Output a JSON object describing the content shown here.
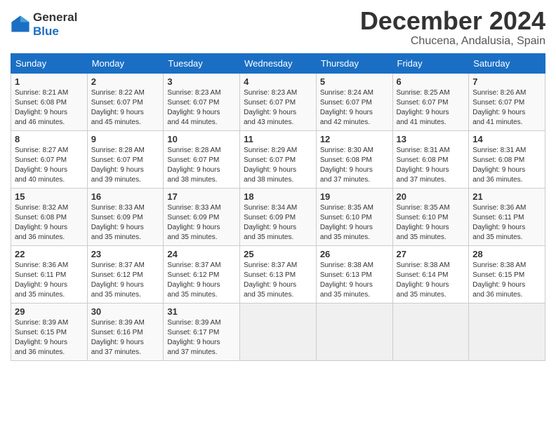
{
  "header": {
    "logo_line1": "General",
    "logo_line2": "Blue",
    "month": "December 2024",
    "location": "Chucena, Andalusia, Spain"
  },
  "weekdays": [
    "Sunday",
    "Monday",
    "Tuesday",
    "Wednesday",
    "Thursday",
    "Friday",
    "Saturday"
  ],
  "weeks": [
    [
      {
        "day": "1",
        "info": "Sunrise: 8:21 AM\nSunset: 6:08 PM\nDaylight: 9 hours\nand 46 minutes."
      },
      {
        "day": "2",
        "info": "Sunrise: 8:22 AM\nSunset: 6:07 PM\nDaylight: 9 hours\nand 45 minutes."
      },
      {
        "day": "3",
        "info": "Sunrise: 8:23 AM\nSunset: 6:07 PM\nDaylight: 9 hours\nand 44 minutes."
      },
      {
        "day": "4",
        "info": "Sunrise: 8:23 AM\nSunset: 6:07 PM\nDaylight: 9 hours\nand 43 minutes."
      },
      {
        "day": "5",
        "info": "Sunrise: 8:24 AM\nSunset: 6:07 PM\nDaylight: 9 hours\nand 42 minutes."
      },
      {
        "day": "6",
        "info": "Sunrise: 8:25 AM\nSunset: 6:07 PM\nDaylight: 9 hours\nand 41 minutes."
      },
      {
        "day": "7",
        "info": "Sunrise: 8:26 AM\nSunset: 6:07 PM\nDaylight: 9 hours\nand 41 minutes."
      }
    ],
    [
      {
        "day": "8",
        "info": "Sunrise: 8:27 AM\nSunset: 6:07 PM\nDaylight: 9 hours\nand 40 minutes."
      },
      {
        "day": "9",
        "info": "Sunrise: 8:28 AM\nSunset: 6:07 PM\nDaylight: 9 hours\nand 39 minutes."
      },
      {
        "day": "10",
        "info": "Sunrise: 8:28 AM\nSunset: 6:07 PM\nDaylight: 9 hours\nand 38 minutes."
      },
      {
        "day": "11",
        "info": "Sunrise: 8:29 AM\nSunset: 6:07 PM\nDaylight: 9 hours\nand 38 minutes."
      },
      {
        "day": "12",
        "info": "Sunrise: 8:30 AM\nSunset: 6:08 PM\nDaylight: 9 hours\nand 37 minutes."
      },
      {
        "day": "13",
        "info": "Sunrise: 8:31 AM\nSunset: 6:08 PM\nDaylight: 9 hours\nand 37 minutes."
      },
      {
        "day": "14",
        "info": "Sunrise: 8:31 AM\nSunset: 6:08 PM\nDaylight: 9 hours\nand 36 minutes."
      }
    ],
    [
      {
        "day": "15",
        "info": "Sunrise: 8:32 AM\nSunset: 6:08 PM\nDaylight: 9 hours\nand 36 minutes."
      },
      {
        "day": "16",
        "info": "Sunrise: 8:33 AM\nSunset: 6:09 PM\nDaylight: 9 hours\nand 35 minutes."
      },
      {
        "day": "17",
        "info": "Sunrise: 8:33 AM\nSunset: 6:09 PM\nDaylight: 9 hours\nand 35 minutes."
      },
      {
        "day": "18",
        "info": "Sunrise: 8:34 AM\nSunset: 6:09 PM\nDaylight: 9 hours\nand 35 minutes."
      },
      {
        "day": "19",
        "info": "Sunrise: 8:35 AM\nSunset: 6:10 PM\nDaylight: 9 hours\nand 35 minutes."
      },
      {
        "day": "20",
        "info": "Sunrise: 8:35 AM\nSunset: 6:10 PM\nDaylight: 9 hours\nand 35 minutes."
      },
      {
        "day": "21",
        "info": "Sunrise: 8:36 AM\nSunset: 6:11 PM\nDaylight: 9 hours\nand 35 minutes."
      }
    ],
    [
      {
        "day": "22",
        "info": "Sunrise: 8:36 AM\nSunset: 6:11 PM\nDaylight: 9 hours\nand 35 minutes."
      },
      {
        "day": "23",
        "info": "Sunrise: 8:37 AM\nSunset: 6:12 PM\nDaylight: 9 hours\nand 35 minutes."
      },
      {
        "day": "24",
        "info": "Sunrise: 8:37 AM\nSunset: 6:12 PM\nDaylight: 9 hours\nand 35 minutes."
      },
      {
        "day": "25",
        "info": "Sunrise: 8:37 AM\nSunset: 6:13 PM\nDaylight: 9 hours\nand 35 minutes."
      },
      {
        "day": "26",
        "info": "Sunrise: 8:38 AM\nSunset: 6:13 PM\nDaylight: 9 hours\nand 35 minutes."
      },
      {
        "day": "27",
        "info": "Sunrise: 8:38 AM\nSunset: 6:14 PM\nDaylight: 9 hours\nand 35 minutes."
      },
      {
        "day": "28",
        "info": "Sunrise: 8:38 AM\nSunset: 6:15 PM\nDaylight: 9 hours\nand 36 minutes."
      }
    ],
    [
      {
        "day": "29",
        "info": "Sunrise: 8:39 AM\nSunset: 6:15 PM\nDaylight: 9 hours\nand 36 minutes."
      },
      {
        "day": "30",
        "info": "Sunrise: 8:39 AM\nSunset: 6:16 PM\nDaylight: 9 hours\nand 37 minutes."
      },
      {
        "day": "31",
        "info": "Sunrise: 8:39 AM\nSunset: 6:17 PM\nDaylight: 9 hours\nand 37 minutes."
      },
      null,
      null,
      null,
      null
    ]
  ]
}
